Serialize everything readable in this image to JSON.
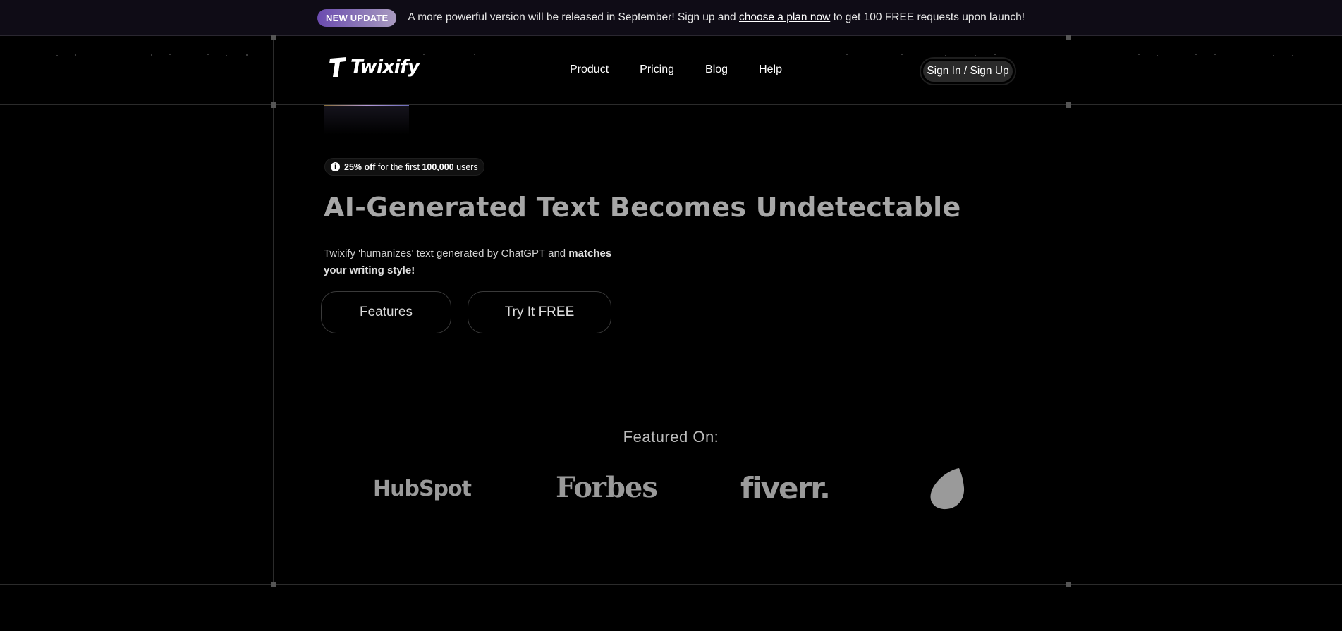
{
  "announcement": {
    "badge": "NEW UPDATE",
    "text_before": "A more powerful version will be released in September! Sign up and ",
    "link": "choose a plan now",
    "text_after": " to get 100 FREE requests upon launch!"
  },
  "header": {
    "logo_text": "Twixify",
    "nav": [
      "Product",
      "Pricing",
      "Blog",
      "Help"
    ],
    "signin_label": "Sign In / Sign Up"
  },
  "hero": {
    "pill": {
      "bold1": "25% off",
      "mid": " for the first ",
      "bold2": "100,000",
      "end": " users"
    },
    "title": "AI-Generated Text Becomes Undetectable",
    "desc_plain": "Twixify 'humanizes' text generated by ChatGPT and ",
    "desc_bold": "matches your writing style!",
    "btn_features": "Features",
    "btn_try": "Try It FREE"
  },
  "featured": {
    "title": "Featured On:",
    "brands": [
      "HubSpot",
      "Forbes",
      "fiverr.",
      "envato-icon"
    ]
  },
  "colors": {
    "badge_start": "#6b4bb0",
    "title_gray": "#a7a7a7",
    "background": "#000000"
  }
}
